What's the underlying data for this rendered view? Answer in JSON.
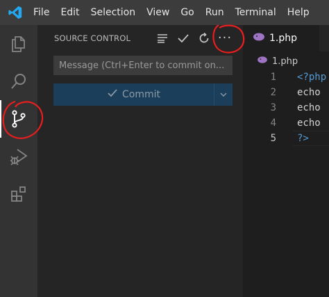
{
  "menu": {
    "items": [
      "File",
      "Edit",
      "Selection",
      "View",
      "Go",
      "Run",
      "Terminal",
      "Help"
    ]
  },
  "activity_bar": {
    "icons": [
      "explorer-icon",
      "search-icon",
      "source-control-icon",
      "run-debug-icon",
      "extensions-icon"
    ],
    "active": "source-control-icon"
  },
  "sidebar": {
    "title": "SOURCE CONTROL",
    "actions": [
      "view-as-tree-icon",
      "commit-check-icon",
      "refresh-icon",
      "more-actions-icon"
    ],
    "more_label": "···",
    "message_placeholder": "Message (Ctrl+Enter to commit on...",
    "commit_label": "Commit"
  },
  "editor": {
    "tab_label": "1.php",
    "breadcrumb_label": "1.php",
    "lines": [
      {
        "num": "1",
        "text": "<?php"
      },
      {
        "num": "2",
        "text": "echo"
      },
      {
        "num": "3",
        "text": "echo"
      },
      {
        "num": "4",
        "text": "echo"
      },
      {
        "num": "5",
        "text": "?>"
      }
    ]
  },
  "colors": {
    "annotation": "#e81e1e",
    "accent": "#007acc",
    "php_icon": "#a074c4"
  }
}
